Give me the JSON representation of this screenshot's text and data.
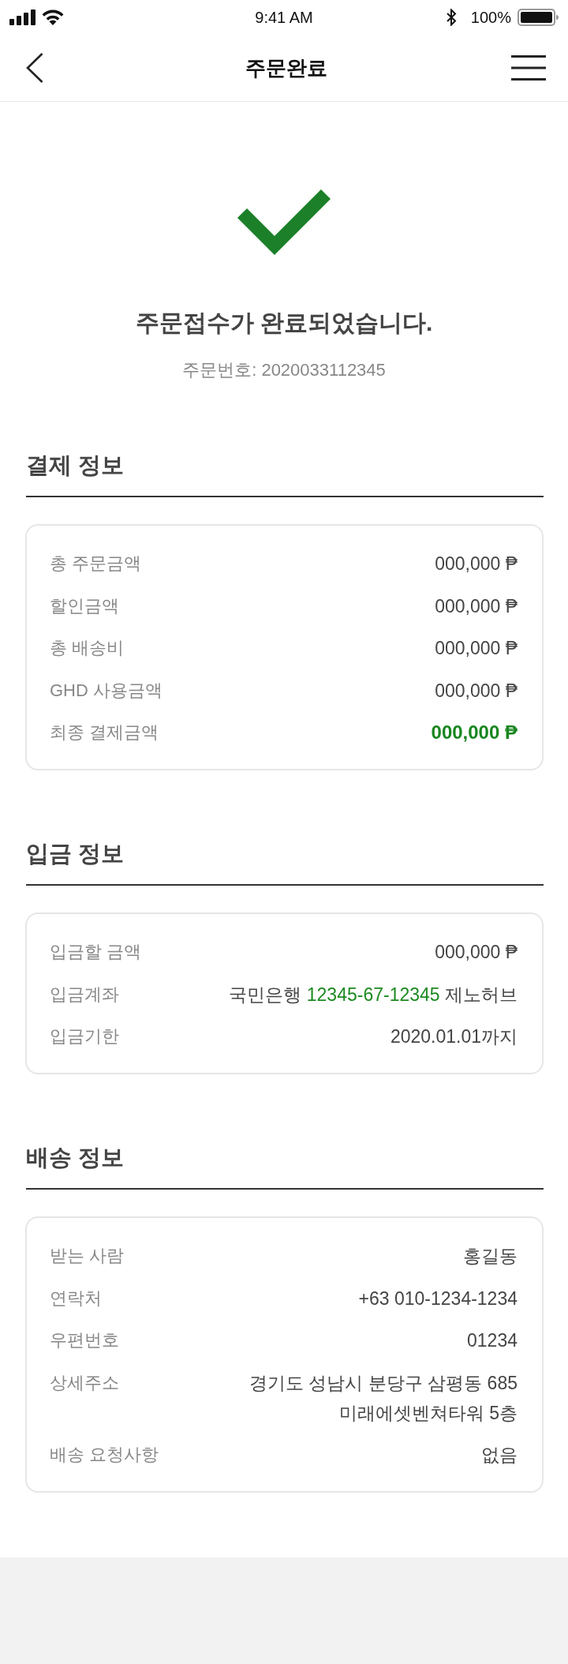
{
  "status_bar": {
    "time": "9:41 AM",
    "battery": "100%"
  },
  "header": {
    "title": "주문완료"
  },
  "confirmation": {
    "message": "주문접수가 완료되었습니다.",
    "order_number": "주문번호: 2020033112345"
  },
  "sections": [
    {
      "title": "결제 정보",
      "rows": [
        {
          "kind": "text",
          "label": "총 주문금액",
          "value": "000,000 ₱",
          "highlighted": false
        },
        {
          "kind": "text",
          "label": "할인금액",
          "value": "000,000 ₱",
          "highlighted": false
        },
        {
          "kind": "text",
          "label": "총 배송비",
          "value": "000,000 ₱",
          "highlighted": false
        },
        {
          "kind": "text",
          "label": "GHD 사용금액",
          "value": "000,000 ₱",
          "highlighted": false
        },
        {
          "kind": "text",
          "label": "최종 결제금액",
          "value": "000,000 ₱",
          "highlighted": true
        }
      ]
    },
    {
      "title": "입금 정보",
      "rows": [
        {
          "kind": "text",
          "label": "입금할 금액",
          "value": "000,000 ₱"
        },
        {
          "kind": "account",
          "label": "입금계좌",
          "bank": "국민은행",
          "account_number": "12345-67-12345",
          "holder": "제노허브"
        },
        {
          "kind": "text",
          "label": "입금기한",
          "value": "2020.01.01까지"
        }
      ]
    },
    {
      "title": "배송 정보",
      "rows": [
        {
          "kind": "text",
          "label": "받는 사람",
          "value": "홍길동"
        },
        {
          "kind": "text",
          "label": "연락처",
          "value": "+63 010-1234-1234"
        },
        {
          "kind": "text",
          "label": "우편번호",
          "value": "01234"
        },
        {
          "kind": "multiline",
          "label": "상세주소",
          "lines": [
            "경기도 성남시 분당구 삼평동 685",
            "미래에셋벤쳐타워 5층"
          ]
        },
        {
          "kind": "text",
          "label": "배송 요청사항",
          "value": "없음"
        }
      ]
    }
  ]
}
